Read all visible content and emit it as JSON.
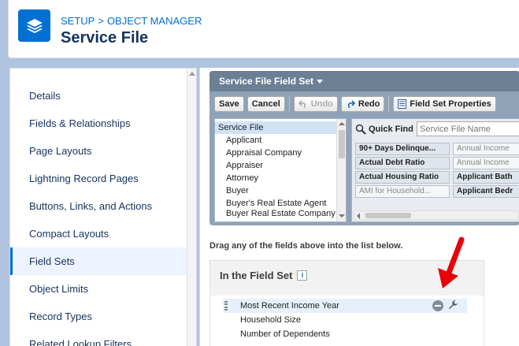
{
  "header": {
    "breadcrumb_setup": "SETUP",
    "breadcrumb_separator": ">",
    "breadcrumb_object_manager": "OBJECT MANAGER",
    "title": "Service File",
    "icon": "layers-icon",
    "icon_color": "#0070d2"
  },
  "sidebar": {
    "items": [
      {
        "label": "Details"
      },
      {
        "label": "Fields & Relationships"
      },
      {
        "label": "Page Layouts"
      },
      {
        "label": "Lightning Record Pages"
      },
      {
        "label": "Buttons, Links, and Actions"
      },
      {
        "label": "Compact Layouts"
      },
      {
        "label": "Field Sets",
        "active": true
      },
      {
        "label": "Object Limits"
      },
      {
        "label": "Record Types"
      },
      {
        "label": "Related Lookup Filters"
      }
    ]
  },
  "field_set_editor": {
    "title": "Service File Field Set",
    "toolbar": {
      "save": "Save",
      "cancel": "Cancel",
      "undo": "Undo",
      "redo": "Redo",
      "properties": "Field Set Properties"
    },
    "tree": {
      "root": "Service File",
      "items": [
        "Applicant",
        "Appraisal Company",
        "Appraiser",
        "Attorney",
        "Buyer",
        "Buyer's Real Estate Agent",
        "Buyer Real Estate Company"
      ]
    },
    "quick_find": {
      "label": "Quick Find",
      "placeholder": "Service File Name"
    },
    "fields": {
      "col1": [
        {
          "label": "90+ Days Delinque...",
          "used": false
        },
        {
          "label": "Actual Debt Ratio",
          "used": false
        },
        {
          "label": "Actual Housing Ratio",
          "used": false
        },
        {
          "label": "AMI for Household...",
          "used": true
        }
      ],
      "col2": [
        {
          "label": "Annual Income",
          "used": true
        },
        {
          "label": "Annual Income",
          "used": true
        },
        {
          "label": "Applicant Bath",
          "used": false
        },
        {
          "label": "Applicant Bedr",
          "used": false
        }
      ]
    }
  },
  "instruction": "Drag any of the fields above into the list below.",
  "in_field_set": {
    "title": "In the Field Set",
    "info": "i",
    "rows": [
      "Most Recent Income Year",
      "Household Size",
      "Number of Dependents"
    ]
  },
  "colors": {
    "page_bg": "#b0c4df",
    "accent": "#0070d2",
    "annotation": "#e8000b"
  }
}
